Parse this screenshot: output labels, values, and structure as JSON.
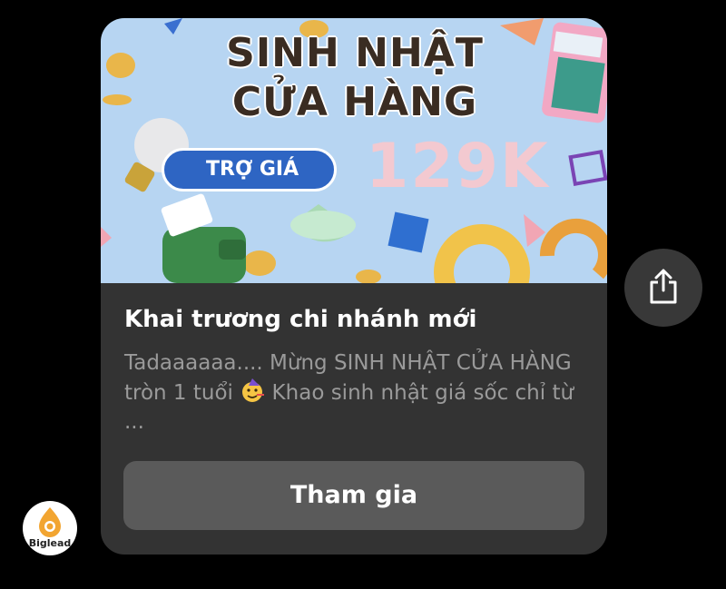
{
  "banner": {
    "title_line1": "SINH NHẬT",
    "title_line2": "CỬA HÀNG",
    "pill_label": "TRỢ GIÁ",
    "price": "129K"
  },
  "card": {
    "title": "Khai trương chi nhánh mới",
    "desc_part1": "Tadaaaaaa.... Mừng SINH NHẬT CỬA HÀNG tròn 1 tuổi ",
    "desc_part2": " Khao sinh nhật giá sốc chỉ từ ...",
    "button_label": "Tham gia"
  },
  "logo": {
    "label": "Biglead"
  },
  "icons": {
    "share": "share-icon",
    "party": "party-face-emoji"
  },
  "colors": {
    "background": "#000000",
    "card": "#333333",
    "button": "#5a5a5a",
    "banner_bg": "#b7d5f2",
    "pill": "#2e65c3"
  }
}
